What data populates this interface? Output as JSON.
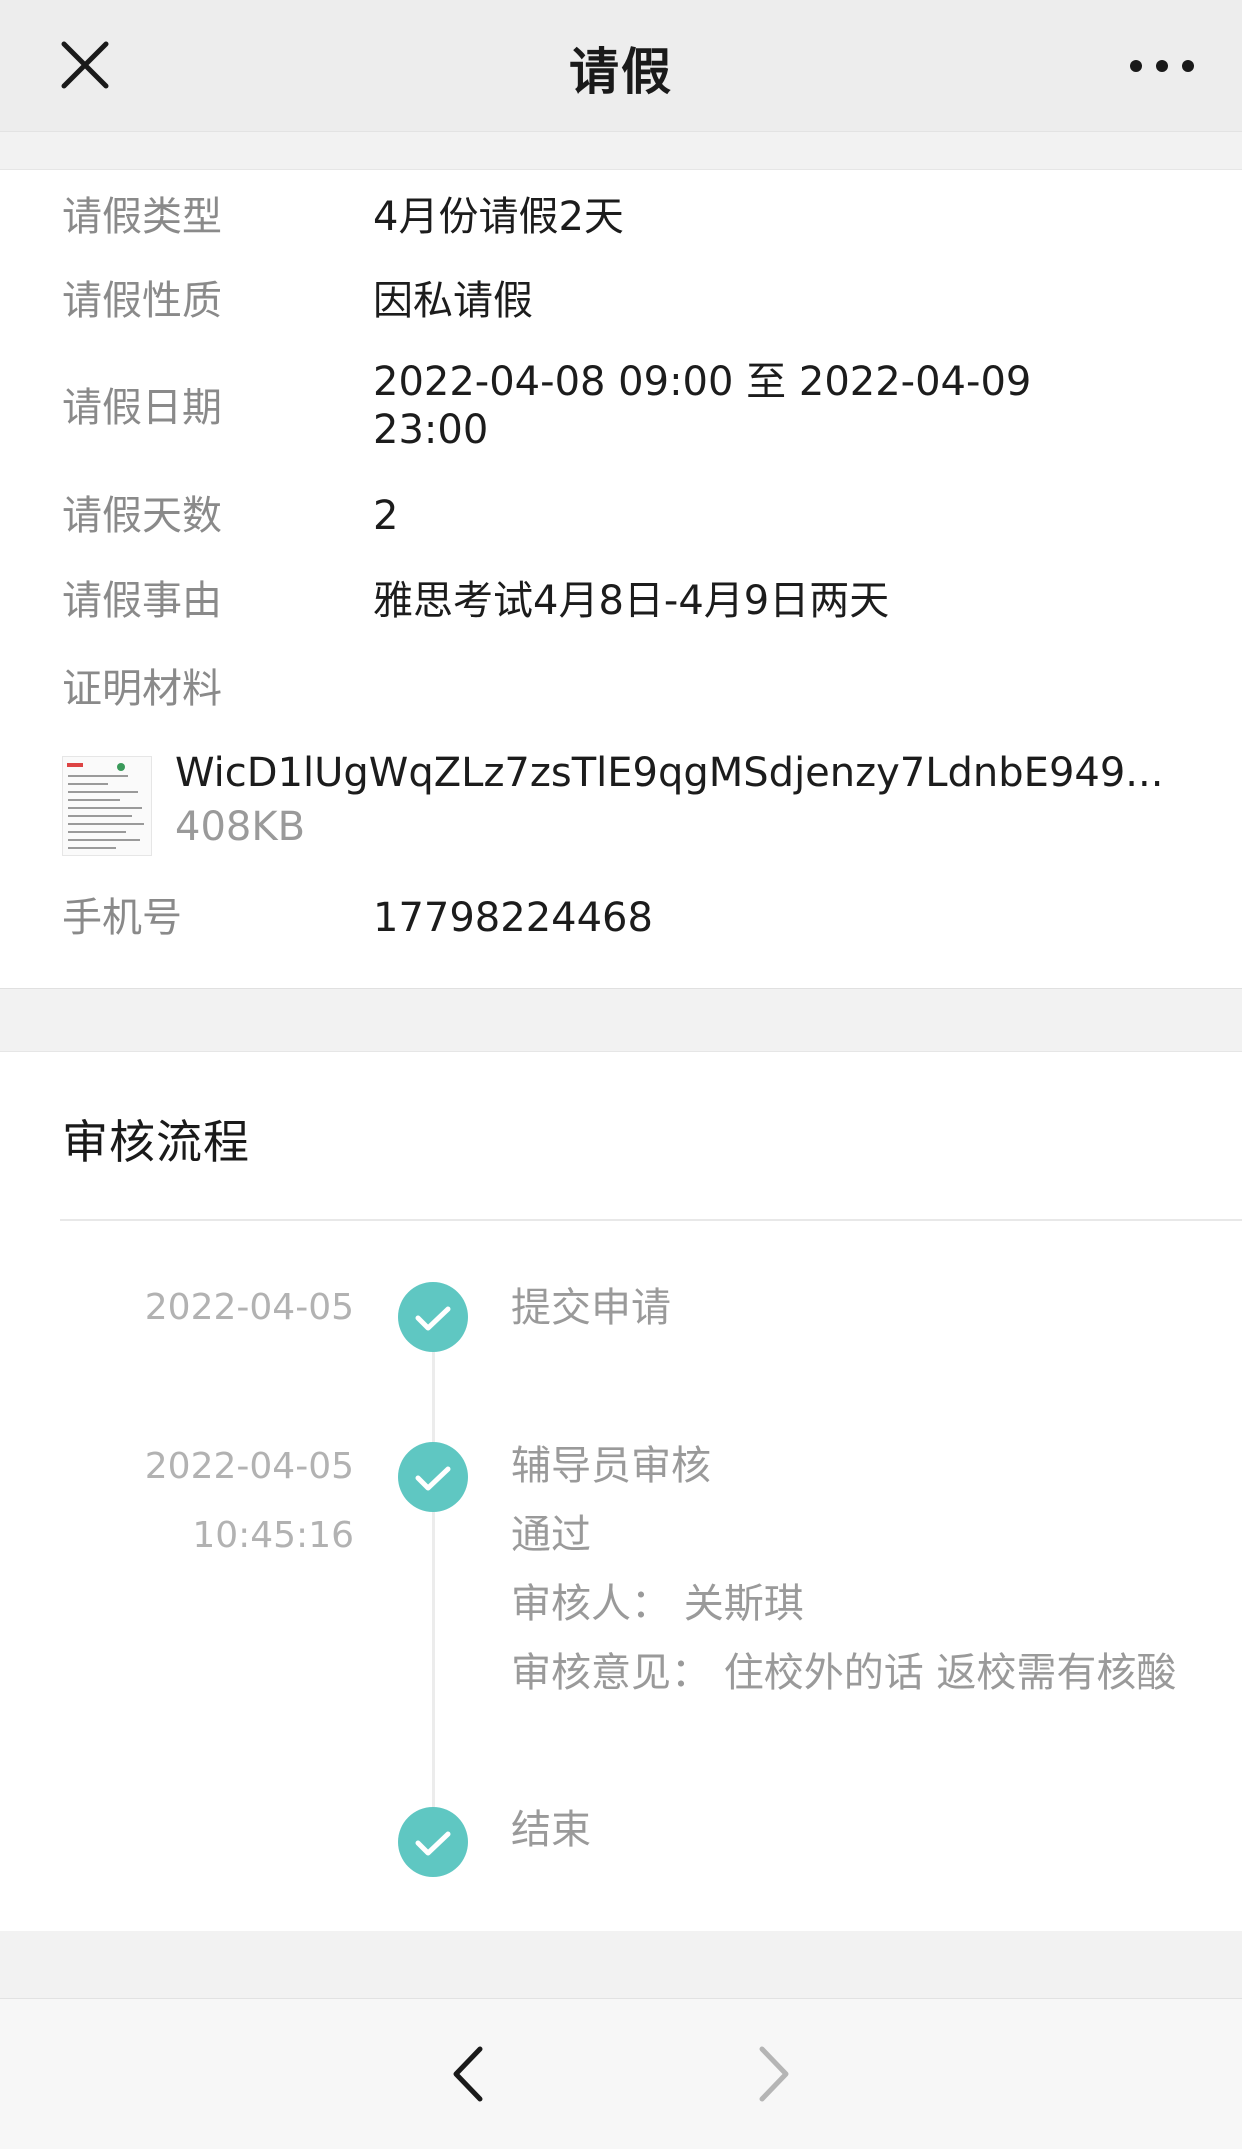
{
  "header": {
    "title": "请假"
  },
  "info": {
    "rows": [
      {
        "label": "请假类型",
        "value": "4月份请假2天"
      },
      {
        "label": "请假性质",
        "value": "因私请假"
      },
      {
        "label": "请假日期",
        "value": "2022-04-08 09:00 至 2022-04-09 23:00"
      },
      {
        "label": "请假天数",
        "value": "2"
      },
      {
        "label": "请假事由",
        "value": "雅思考试4月8日-4月9日两天"
      },
      {
        "label": "证明材料"
      },
      {
        "label": "手机号",
        "value": "17798224468"
      }
    ],
    "attachment": {
      "filename": "WicD1lUgWqZLz7zsTlE9qgMSdjenzy7LdnbE949...",
      "size": "408KB"
    }
  },
  "process": {
    "title": "审核流程",
    "steps": [
      {
        "date": "2022-04-05",
        "name": "提交申请",
        "status": "done"
      },
      {
        "date": "2022-04-05",
        "time": "10:45:16",
        "name": "辅导员审核",
        "result": "通过",
        "reviewer": "审核人：  关斯琪",
        "opinion": "审核意见：  住校外的话 返校需有核酸",
        "status": "done"
      },
      {
        "name": "结束",
        "status": "done"
      }
    ]
  },
  "icons": {
    "close": "close-icon",
    "more": "more-dots-icon",
    "check": "check-circle-icon",
    "back": "chevron-left-icon",
    "forward": "chevron-right-icon",
    "attachment_thumb": "document-thumbnail"
  },
  "colors": {
    "accent": "#5fc7c2",
    "label": "#8a8a8a",
    "muted": "#b2b2b2"
  }
}
